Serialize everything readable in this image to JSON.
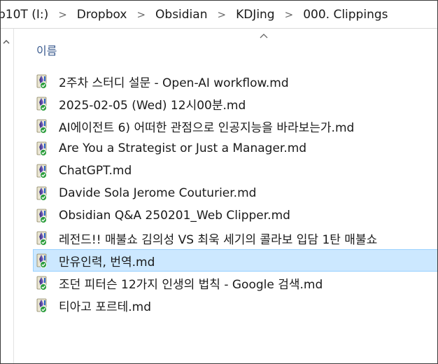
{
  "breadcrumb": {
    "items": [
      "p10T (I:)",
      "Dropbox",
      "Obsidian",
      "KDJing",
      "000. Clippings"
    ],
    "separator": ">"
  },
  "header": {
    "name_column": "이름",
    "sort_icon": "chevron-up-icon"
  },
  "files": [
    {
      "name": "2주차 스터디 설문 - Open-AI  workflow.md",
      "icon": "sync-file-icon",
      "selected": false
    },
    {
      "name": "2025-02-05 (Wed) 12시00분.md",
      "icon": "sync-file-icon",
      "selected": false
    },
    {
      "name": "AI에이전트 6) 어떠한 관점으로 인공지능을 바라보는가.md",
      "icon": "sync-file-icon",
      "selected": false
    },
    {
      "name": "Are You a Strategist or Just a Manager.md",
      "icon": "sync-file-icon",
      "selected": false
    },
    {
      "name": "ChatGPT.md",
      "icon": "sync-file-icon",
      "selected": false
    },
    {
      "name": "Davide Sola Jerome Couturier.md",
      "icon": "sync-file-icon",
      "selected": false
    },
    {
      "name": "Obsidian Q&A 250201_Web Clipper.md",
      "icon": "sync-file-icon",
      "selected": false
    },
    {
      "name": "레전드!! 매불쇼 김의성 VS 최욱 세기의 콜라보 입담 1탄  매불쇼",
      "icon": "sync-file-icon",
      "selected": false
    },
    {
      "name": "만유인력, 번역.md",
      "icon": "sync-file-icon",
      "selected": true
    },
    {
      "name": "조던 피터슨 12가지 인생의 법칙 - Google 검색.md",
      "icon": "sync-file-icon",
      "selected": false
    },
    {
      "name": "티아고 포르테.md",
      "icon": "sync-file-icon",
      "selected": false
    }
  ],
  "colors": {
    "selection_bg": "#cce8ff",
    "selection_border": "#99d1ff",
    "header_text": "#3b5b8f",
    "sync_check": "#2e9e3e"
  }
}
